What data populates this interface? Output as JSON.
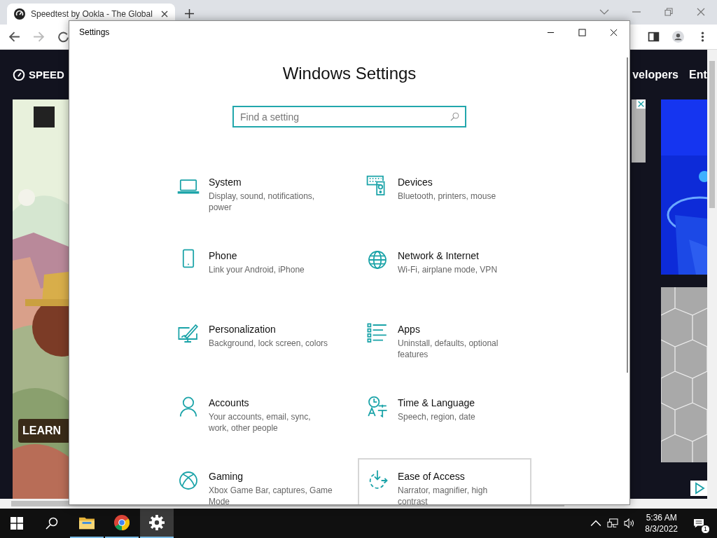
{
  "browser": {
    "tab": {
      "title": "Speedtest by Ookla - The Global"
    },
    "page": {
      "logo": "SPEED",
      "nav": [
        "velopers",
        "Ent"
      ],
      "ad_button": "LEARN"
    }
  },
  "settings_window": {
    "title": "Settings",
    "heading": "Windows Settings",
    "search": {
      "placeholder": "Find a setting"
    },
    "items": [
      {
        "kind": "system",
        "name": "System",
        "description": "Display, sound, notifications, power",
        "hovered": false
      },
      {
        "kind": "devices",
        "name": "Devices",
        "description": "Bluetooth, printers, mouse",
        "hovered": false
      },
      {
        "kind": "phone",
        "name": "Phone",
        "description": "Link your Android, iPhone",
        "hovered": false
      },
      {
        "kind": "network",
        "name": "Network & Internet",
        "description": "Wi-Fi, airplane mode, VPN",
        "hovered": false
      },
      {
        "kind": "personalization",
        "name": "Personalization",
        "description": "Background, lock screen, colors",
        "hovered": false
      },
      {
        "kind": "apps",
        "name": "Apps",
        "description": "Uninstall, defaults, optional features",
        "hovered": false
      },
      {
        "kind": "accounts",
        "name": "Accounts",
        "description": "Your accounts, email, sync, work, other people",
        "hovered": false
      },
      {
        "kind": "time",
        "name": "Time & Language",
        "description": "Speech, region, date",
        "hovered": false
      },
      {
        "kind": "gaming",
        "name": "Gaming",
        "description": "Xbox Game Bar, captures, Game Mode",
        "hovered": false
      },
      {
        "kind": "ease",
        "name": "Ease of Access",
        "description": "Narrator, magnifier, high contrast",
        "hovered": true
      }
    ]
  },
  "taskbar": {
    "apps": [
      {
        "kind": "explorer",
        "selected": false
      },
      {
        "kind": "browser",
        "selected": false
      },
      {
        "kind": "settings",
        "selected": true
      }
    ],
    "time": "5:36 AM",
    "date": "8/3/2022",
    "notification_count": "1"
  }
}
